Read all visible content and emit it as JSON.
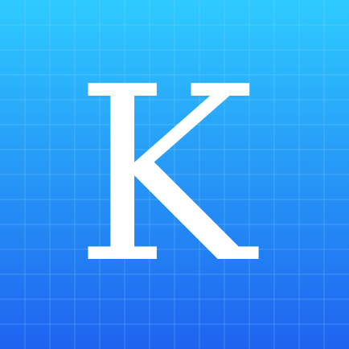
{
  "icon": {
    "letter": "K",
    "colors": {
      "gradient_top": "#2ecbff",
      "gradient_bottom": "#1e63ef",
      "grid_line": "#9fdcff",
      "letter": "#ffffff"
    }
  }
}
